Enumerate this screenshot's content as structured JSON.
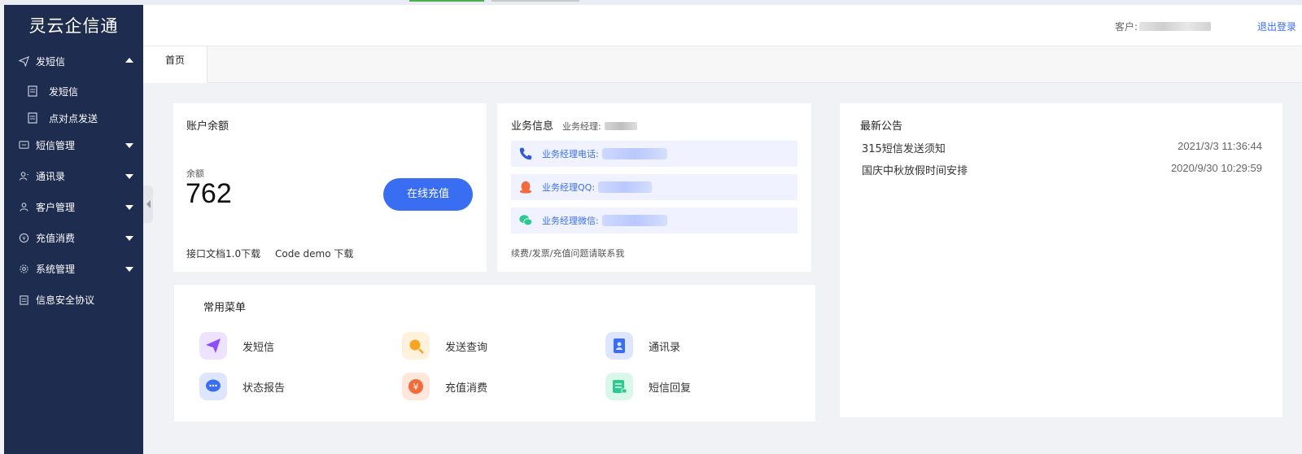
{
  "app": {
    "title": "灵云企信通"
  },
  "sidebar": {
    "items": [
      {
        "label": "发短信",
        "icon": "paper-plane-icon",
        "expanded": true
      },
      {
        "label": "发短信",
        "icon": "document-icon",
        "sub": true
      },
      {
        "label": "点对点发送",
        "icon": "document-icon",
        "sub": true
      },
      {
        "label": "短信管理",
        "icon": "message-icon"
      },
      {
        "label": "通讯录",
        "icon": "contacts-icon"
      },
      {
        "label": "客户管理",
        "icon": "user-icon"
      },
      {
        "label": "充值消费",
        "icon": "coin-icon"
      },
      {
        "label": "系统管理",
        "icon": "gear-icon"
      },
      {
        "label": "信息安全协议",
        "icon": "clipboard-icon"
      }
    ]
  },
  "header": {
    "customer_label": "客户:",
    "logout_label": "退出登录"
  },
  "tabs": [
    {
      "label": "首页"
    }
  ],
  "balance_card": {
    "title": "账户余额",
    "balance_label": "余额",
    "balance_value": "762",
    "recharge_label": "在线充值",
    "doc_link": "接口文档1.0下载",
    "demo_link": "Code demo 下载"
  },
  "business_card": {
    "title": "业务信息",
    "manager_label": "业务经理:",
    "rows": [
      {
        "label": "业务经理电话:",
        "icon": "phone-icon"
      },
      {
        "label": "业务经理QQ:",
        "icon": "qq-icon"
      },
      {
        "label": "业务经理微信:",
        "icon": "wechat-icon"
      }
    ],
    "note": "续费/发票/充值问题请联系我"
  },
  "notice_card": {
    "title": "最新公告",
    "items": [
      {
        "title": "315短信发送须知",
        "date": "2021/3/3 11:36:44"
      },
      {
        "title": "国庆中秋放假时间安排",
        "date": "2020/9/30 10:29:59"
      }
    ]
  },
  "common_menu": {
    "title": "常用菜单",
    "items": [
      {
        "label": "发短信",
        "icon": "send-icon",
        "color": "#8a4dff"
      },
      {
        "label": "发送查询",
        "icon": "search-icon",
        "color": "#f5a623"
      },
      {
        "label": "通讯录",
        "icon": "contacts-book-icon",
        "color": "#3a6ef2"
      },
      {
        "label": "状态报告",
        "icon": "chat-bubble-icon",
        "color": "#3a6ef2"
      },
      {
        "label": "充值消费",
        "icon": "yen-icon",
        "color": "#f26b3a"
      },
      {
        "label": "短信回复",
        "icon": "reply-icon",
        "color": "#2ec98f"
      }
    ]
  }
}
